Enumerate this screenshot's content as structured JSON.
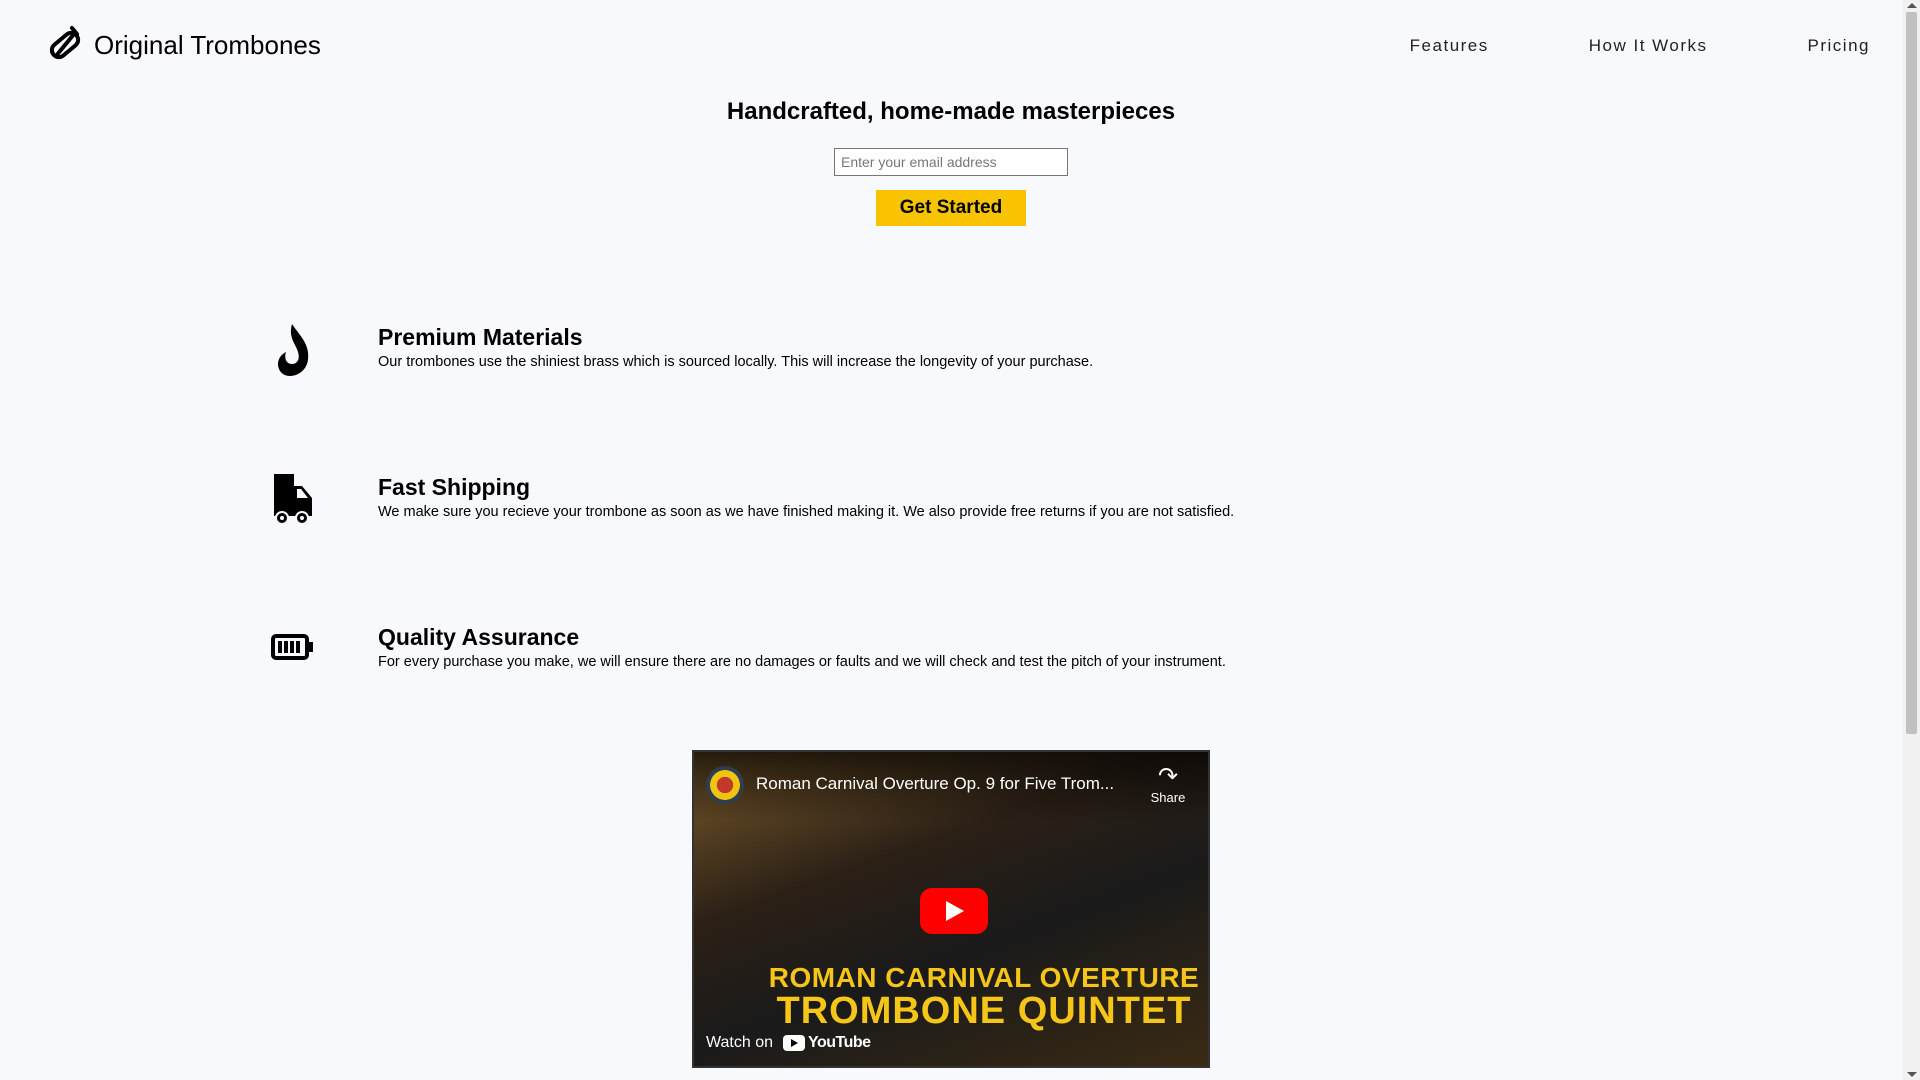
{
  "header": {
    "brand": "Original Trombones",
    "nav": [
      "Features",
      "How It Works",
      "Pricing"
    ]
  },
  "hero": {
    "title": "Handcrafted, home-made masterpieces",
    "email_placeholder": "Enter your email address",
    "cta_label": "Get Started"
  },
  "features": [
    {
      "icon": "fire-icon",
      "title": "Premium Materials",
      "text": "Our trombones use the shiniest brass which is sourced locally. This will increase the longevity of your purchase."
    },
    {
      "icon": "truck-icon",
      "title": "Fast Shipping",
      "text": "We make sure you recieve your trombone as soon as we have finished making it. We also provide free returns if you are not satisfied."
    },
    {
      "icon": "battery-icon",
      "title": "Quality Assurance",
      "text": "For every purchase you make, we will ensure there are no damages or faults and we will check and test the pitch of your instrument."
    }
  ],
  "video": {
    "title": "Roman Carnival Overture Op. 9 for Five Trom...",
    "share_label": "Share",
    "caption_line1": "ROMAN CARNIVAL OVERTURE",
    "caption_line2": "TROMBONE QUINTET",
    "watch_on": "Watch on",
    "platform": "YouTube"
  },
  "colors": {
    "cta": "#f8c300",
    "background": "#f8f9fc",
    "play": "#ff0000"
  }
}
